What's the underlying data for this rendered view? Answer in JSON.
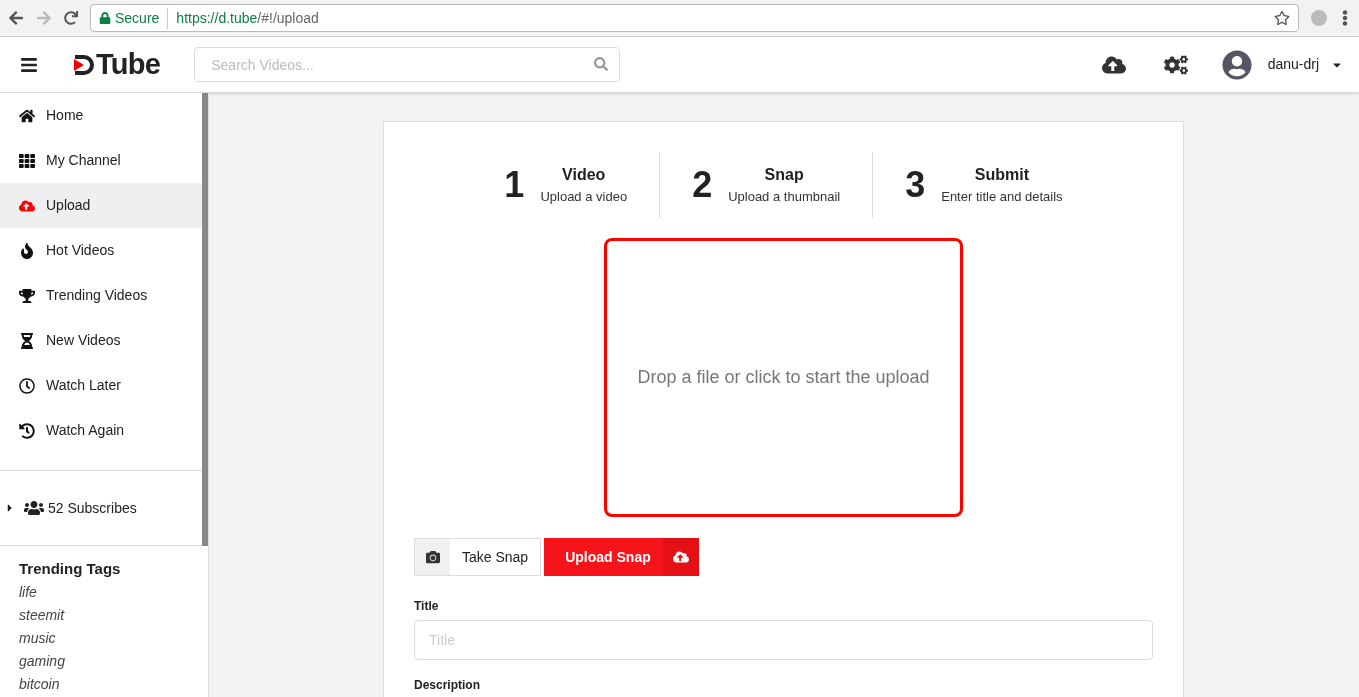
{
  "browser": {
    "secure_label": "Secure",
    "url_host": "https://d.tube",
    "url_path": "/#!/upload"
  },
  "header": {
    "logo": "Tube",
    "search": {
      "placeholder": "Search Videos..."
    },
    "username": "danu-drj"
  },
  "sidebar": {
    "items": [
      {
        "label": "Home",
        "selected": false
      },
      {
        "label": "My Channel",
        "selected": false
      },
      {
        "label": "Upload",
        "selected": true
      },
      {
        "label": "Hot Videos",
        "selected": false
      },
      {
        "label": "Trending Videos",
        "selected": false
      },
      {
        "label": "New Videos",
        "selected": false
      },
      {
        "label": "Watch Later",
        "selected": false
      },
      {
        "label": "Watch Again",
        "selected": false
      }
    ],
    "subscribes": {
      "label": "52 Subscribes",
      "expanded": false
    },
    "trending_tags": {
      "title": "Trending Tags",
      "tags": [
        "life",
        "steemit",
        "music",
        "gaming",
        "bitcoin"
      ]
    }
  },
  "steps": [
    {
      "number": "1",
      "title": "Video",
      "subtitle": "Upload a video"
    },
    {
      "number": "2",
      "title": "Snap",
      "subtitle": "Upload a thumbnail"
    },
    {
      "number": "3",
      "title": "Submit",
      "subtitle": "Enter title and details"
    }
  ],
  "dropzone": {
    "text": "Drop a file or click to start the upload"
  },
  "snap_buttons": {
    "take": "Take Snap",
    "upload": "Upload Snap"
  },
  "form": {
    "title_label": "Title",
    "title_placeholder": "Title",
    "description_label": "Description"
  }
}
